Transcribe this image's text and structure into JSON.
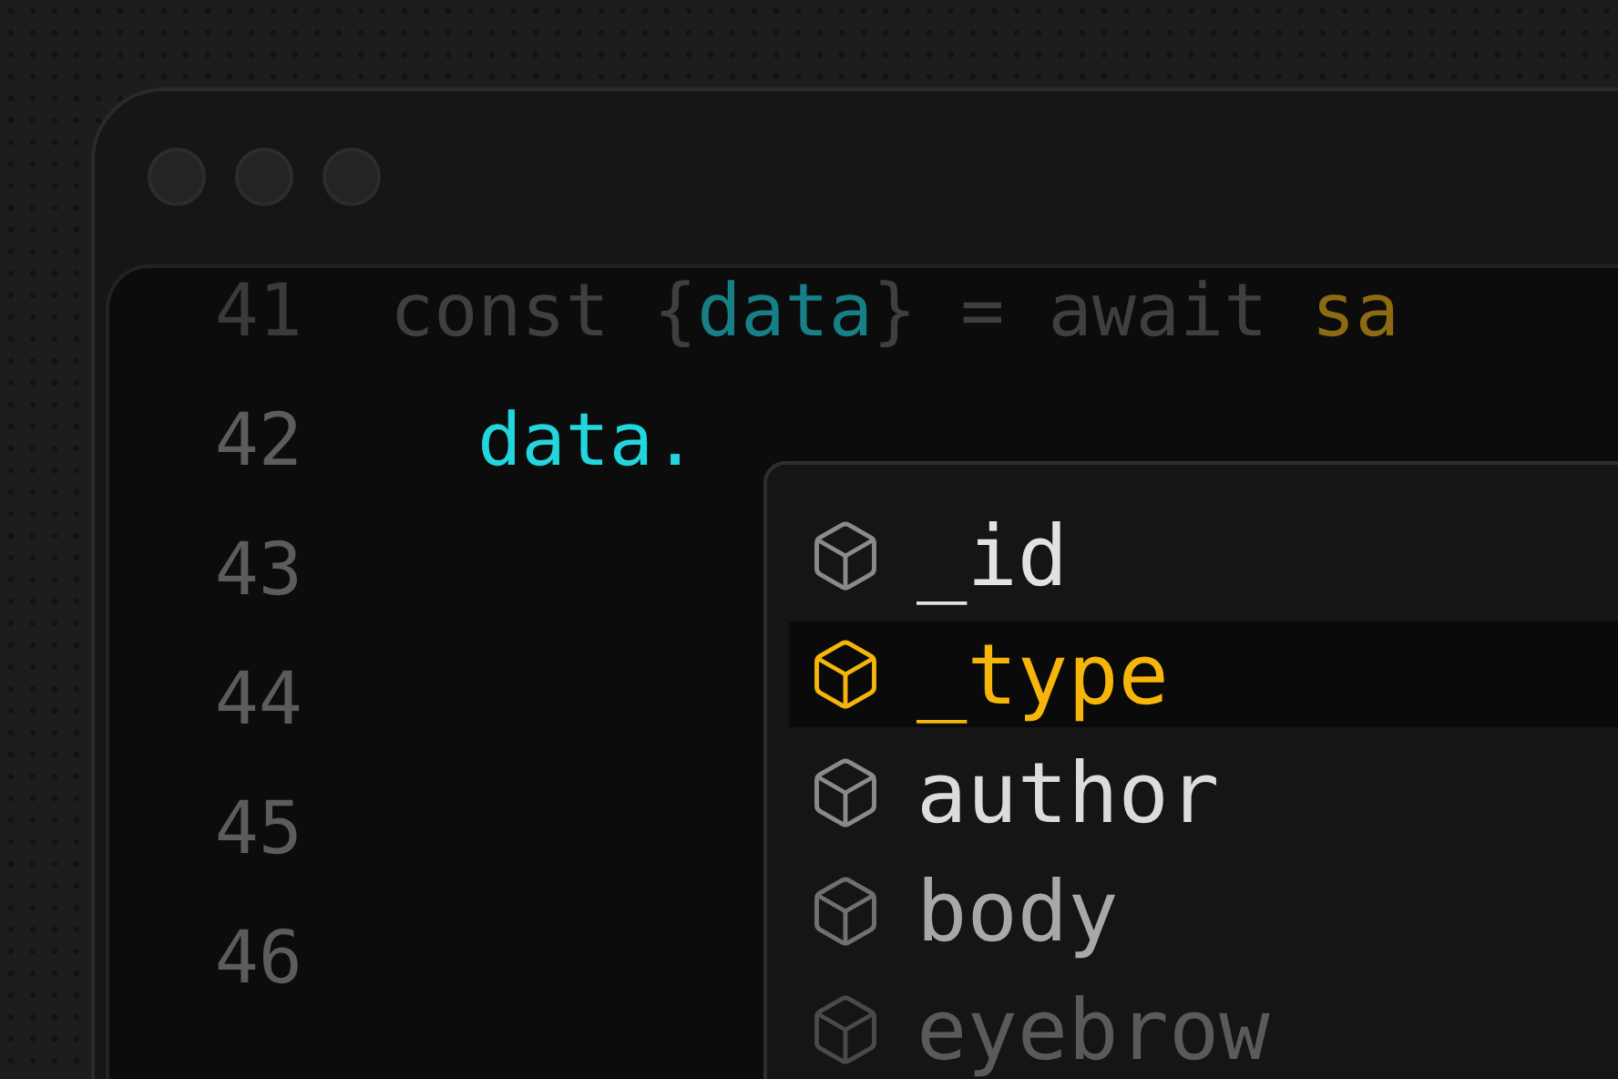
{
  "editor": {
    "lines": [
      {
        "number": "41",
        "tokens": [
          {
            "text": "const ",
            "kind": "keyword"
          },
          {
            "text": "{",
            "kind": "punct"
          },
          {
            "text": "data",
            "kind": "variable"
          },
          {
            "text": "} = await ",
            "kind": "punct"
          },
          {
            "text": "sa",
            "kind": "function"
          }
        ]
      },
      {
        "number": "42",
        "tokens": [
          {
            "text": "  data.",
            "kind": "property"
          }
        ]
      },
      {
        "number": "43"
      },
      {
        "number": "44"
      },
      {
        "number": "45"
      },
      {
        "number": "46"
      }
    ]
  },
  "autocomplete": {
    "items": [
      {
        "label": "_id",
        "selected": false
      },
      {
        "label": "_type",
        "selected": true
      },
      {
        "label": "author",
        "selected": false
      },
      {
        "label": "body",
        "selected": false
      },
      {
        "label": "eyebrow",
        "selected": false
      }
    ]
  }
}
